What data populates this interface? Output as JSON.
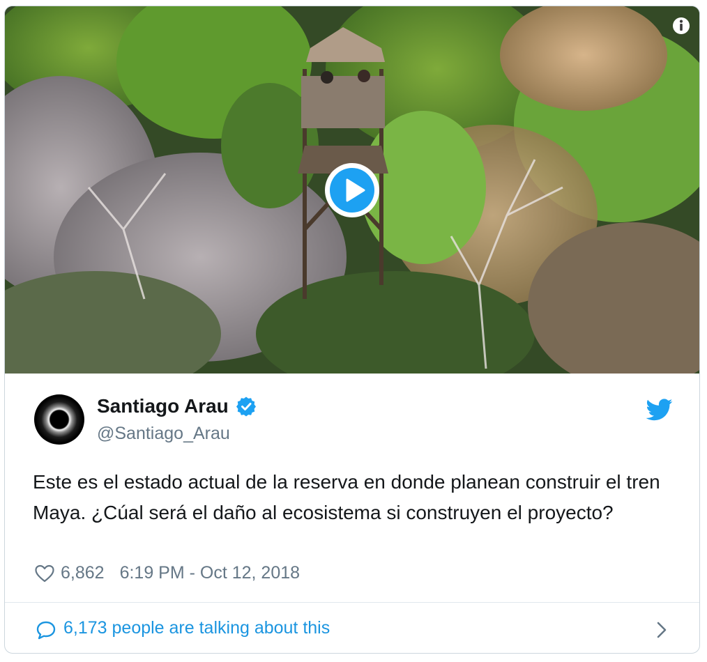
{
  "media": {
    "info_symbol": "i",
    "play_icon": "play-icon",
    "info_icon": "info-icon"
  },
  "tweet": {
    "author_name": "Santiago Arau",
    "handle": "@Santiago_Arau",
    "verified": true,
    "text": "Este es el estado actual de la reserva en donde planean construir el tren Maya. ¿Cúal será el daño al ecosistema si construyen el proyecto?",
    "likes": "6,862",
    "timestamp": "6:19 PM - Oct 12, 2018"
  },
  "footer": {
    "talking_label": "6,173 people are talking about this"
  },
  "colors": {
    "brand_blue": "#1da1f2",
    "link_blue": "#1b95e0",
    "text_primary": "#14171a",
    "text_secondary": "#657786",
    "border": "#ccd6dd"
  }
}
